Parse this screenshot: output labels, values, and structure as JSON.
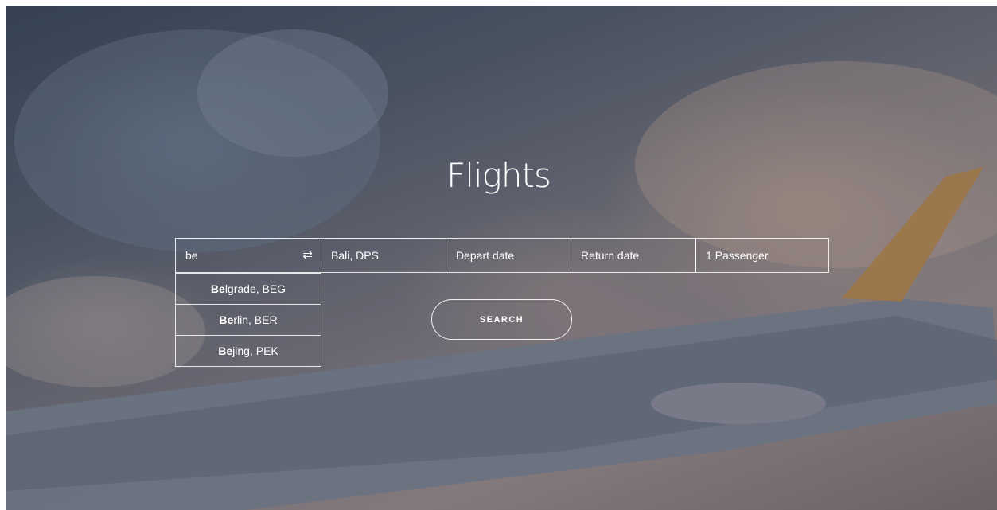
{
  "hero": {
    "title": "Flights"
  },
  "form": {
    "from": {
      "value": "be"
    },
    "to": {
      "value": "Bali, DPS"
    },
    "depart": {
      "placeholder": "Depart date"
    },
    "return": {
      "placeholder": "Return date"
    },
    "passengers": {
      "value": "1 Passenger"
    },
    "search_label": "SEARCH"
  },
  "suggestions": [
    {
      "match": "Be",
      "rest": "lgrade, BEG"
    },
    {
      "match": "Be",
      "rest": "rlin, BER"
    },
    {
      "match": "Be",
      "rest": "jing, PEK"
    }
  ],
  "icons": {
    "swap": "swap-arrows-icon"
  }
}
